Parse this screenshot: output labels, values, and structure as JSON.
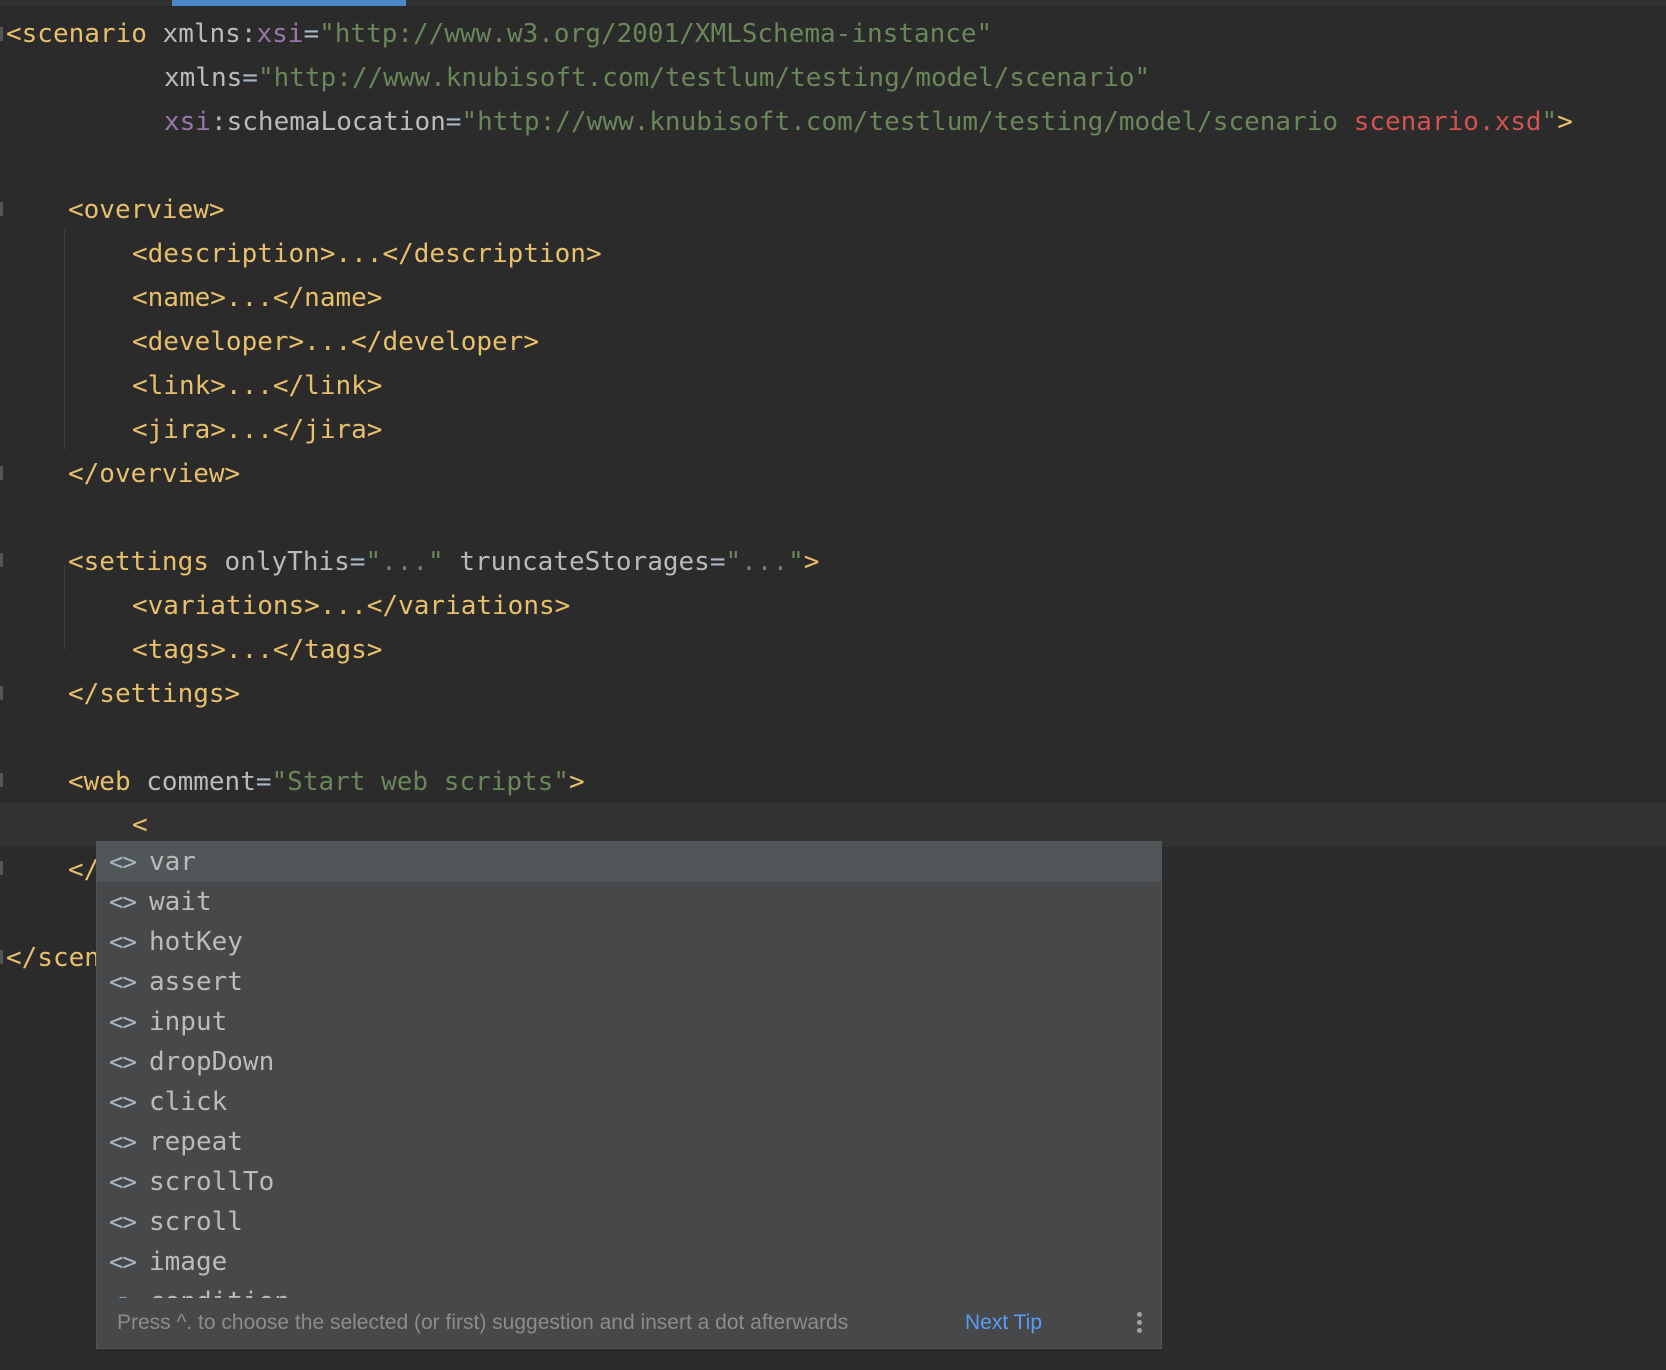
{
  "editor": {
    "lines": {
      "scenario_open": {
        "tag": "<scenario",
        "attr1_ns": "xmlns",
        "attr1_colon": ":",
        "attr1_name": "xsi",
        "attr1_eq": "=",
        "attr1_value": "\"http://www.w3.org/2001/XMLSchema-instance\""
      },
      "xmlns_line": {
        "attr": "xmlns",
        "eq": "=",
        "value": "\"http://www.knubisoft.com/testlum/testing/model/scenario\""
      },
      "schema_line": {
        "ns": "xsi",
        "colon": ":",
        "attr": "schemaLocation",
        "eq": "=",
        "value_start": "\"http://www.knubisoft.com/testlum/testing/model/scenario ",
        "value_err": "scenario.xsd",
        "value_end": "\"",
        "close": ">"
      },
      "overview_open": "<overview>",
      "description": "<description>...</description>",
      "name": "<name>...</name>",
      "developer": "<developer>...</developer>",
      "link": "<link>...</link>",
      "jira": "<jira>...</jira>",
      "overview_close": "</overview>",
      "settings_open": {
        "tag": "<settings",
        "attr1": "onlyThis",
        "eq1": "=",
        "val1": "\"...\"",
        "attr2": "truncateStorages",
        "eq2": "=",
        "val2": "\"...\"",
        "close": ">"
      },
      "variations": "<variations>...</variations>",
      "tags": "<tags>...</tags>",
      "settings_close": "</settings>",
      "web_open": {
        "tag": "<web",
        "attr": "comment",
        "eq": "=",
        "val": "\"Start web scripts\"",
        "close": ">"
      },
      "cursor_line": "<",
      "web_close_partial": "</",
      "scenario_close_partial": "</scen"
    }
  },
  "completion": {
    "items": [
      {
        "icon": "<>",
        "label": "var"
      },
      {
        "icon": "<>",
        "label": "wait"
      },
      {
        "icon": "<>",
        "label": "hotKey"
      },
      {
        "icon": "<>",
        "label": "assert"
      },
      {
        "icon": "<>",
        "label": "input"
      },
      {
        "icon": "<>",
        "label": "dropDown"
      },
      {
        "icon": "<>",
        "label": "click"
      },
      {
        "icon": "<>",
        "label": "repeat"
      },
      {
        "icon": "<>",
        "label": "scrollTo"
      },
      {
        "icon": "<>",
        "label": "scroll"
      },
      {
        "icon": "<>",
        "label": "image"
      },
      {
        "icon": "<>",
        "label": "condition"
      }
    ],
    "footer_hint": "Press ^. to choose the selected (or first) suggestion and insert a dot afterwards",
    "next_tip": "Next Tip"
  }
}
